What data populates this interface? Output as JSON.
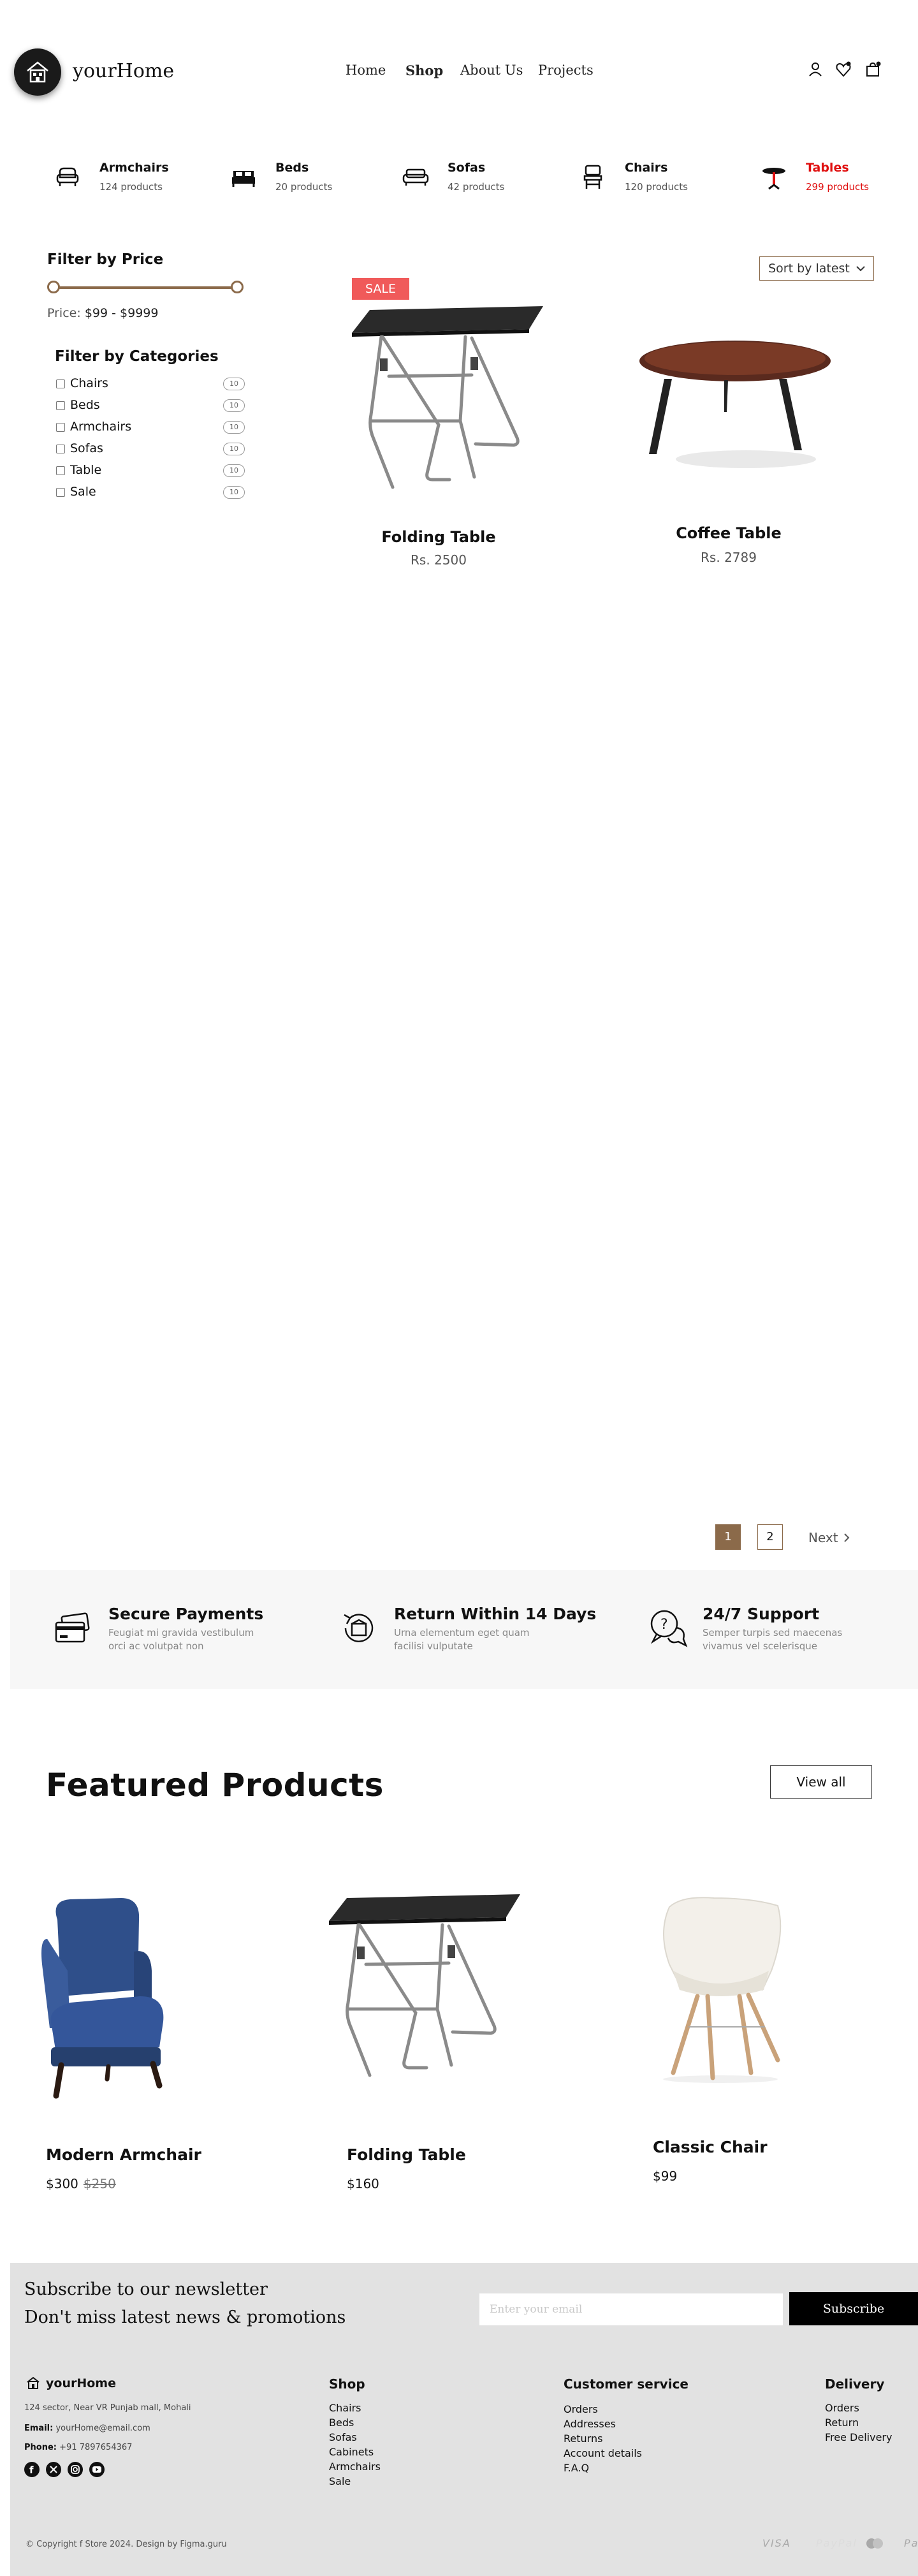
{
  "header": {
    "logo_text": "yourHome",
    "nav": [
      {
        "label": "Home",
        "active": false
      },
      {
        "label": "Shop",
        "active": true
      },
      {
        "label": "About Us",
        "active": false
      },
      {
        "label": "Projects",
        "active": false
      }
    ],
    "icons": [
      "user-icon",
      "wishlist-icon",
      "cart-icon"
    ]
  },
  "categories": [
    {
      "name": "Armchairs",
      "count": "124 products",
      "icon": "armchair-icon",
      "highlighted": false
    },
    {
      "name": "Beds",
      "count": "20 products",
      "icon": "bed-icon",
      "highlighted": false
    },
    {
      "name": "Sofas",
      "count": "42 products",
      "icon": "sofa-icon",
      "highlighted": false
    },
    {
      "name": "Chairs",
      "count": "120 products",
      "icon": "chair-icon",
      "highlighted": false
    },
    {
      "name": "Tables",
      "count": "299 products",
      "icon": "table-icon",
      "highlighted": true,
      "color": "#e01010"
    }
  ],
  "filters": {
    "price_title": "Filter by Price",
    "price_prefix": "Price:",
    "price_range": "$99 - $9999",
    "categories_title": "Filter by Categories",
    "category_items": [
      {
        "label": "Chairs",
        "count": "10"
      },
      {
        "label": "Beds",
        "count": "10"
      },
      {
        "label": "Armchairs",
        "count": "10"
      },
      {
        "label": "Sofas",
        "count": "10"
      },
      {
        "label": "Table",
        "count": "10"
      },
      {
        "label": "Sale",
        "count": "10"
      }
    ]
  },
  "sort": {
    "label": "Sort by latest"
  },
  "products": [
    {
      "name": "Folding Table",
      "price": "Rs. 2500",
      "badge": "SALE"
    },
    {
      "name": "Coffee Table",
      "price": "Rs. 2789"
    }
  ],
  "pagination": {
    "pages": [
      "1",
      "2"
    ],
    "current": "1",
    "next_label": "Next"
  },
  "features": [
    {
      "title": "Secure Payments",
      "desc": "Feugiat mi gravida vestibulum orci ac volutpat non",
      "icon": "credit-card-icon"
    },
    {
      "title": "Return Within 14 Days",
      "desc": "Urna elementum eget quam facilisi vulputate",
      "icon": "return-icon"
    },
    {
      "title": "24/7 Support",
      "desc": "Semper turpis sed maecenas vivamus vel scelerisque",
      "icon": "support-chat-icon"
    }
  ],
  "featured": {
    "title": "Featured Products",
    "view_all": "View all",
    "items": [
      {
        "name": "Modern Armchair",
        "price": "$300",
        "old_price": "$250"
      },
      {
        "name": "Folding Table",
        "price": "$160"
      },
      {
        "name": "Classic Chair",
        "price": "$99"
      }
    ]
  },
  "footer": {
    "newsletter_line1": "Subscribe to our newsletter",
    "newsletter_line2": "Don't miss latest news & promotions",
    "email_placeholder": "Enter your email",
    "subscribe_label": "Subscribe",
    "brand": "yourHome",
    "address": "124 sector, Near VR Punjab mall, Mohali",
    "email_label": "Email:",
    "email_value": "yourHome@email.com",
    "phone_label": "Phone:",
    "phone_value": "+91 7897654367",
    "social": [
      "facebook-icon",
      "x-icon",
      "instagram-icon",
      "youtube-icon"
    ],
    "columns": [
      {
        "title": "Shop",
        "links": [
          "Chairs",
          "Beds",
          "Sofas",
          "Cabinets",
          "Armchairs",
          "Sale"
        ]
      },
      {
        "title": "Customer service",
        "links": [
          "Orders",
          "Addresses",
          "Returns",
          "Account details",
          "F.A.Q"
        ]
      },
      {
        "title": "Delivery",
        "links": [
          "Orders",
          "Return",
          "Free Delivery"
        ]
      }
    ],
    "copyright": "© Copyright f Store 2024. Design by Figma.guru",
    "payments": [
      "VISA",
      "PayPal",
      "Mastercard",
      "Pay"
    ]
  }
}
